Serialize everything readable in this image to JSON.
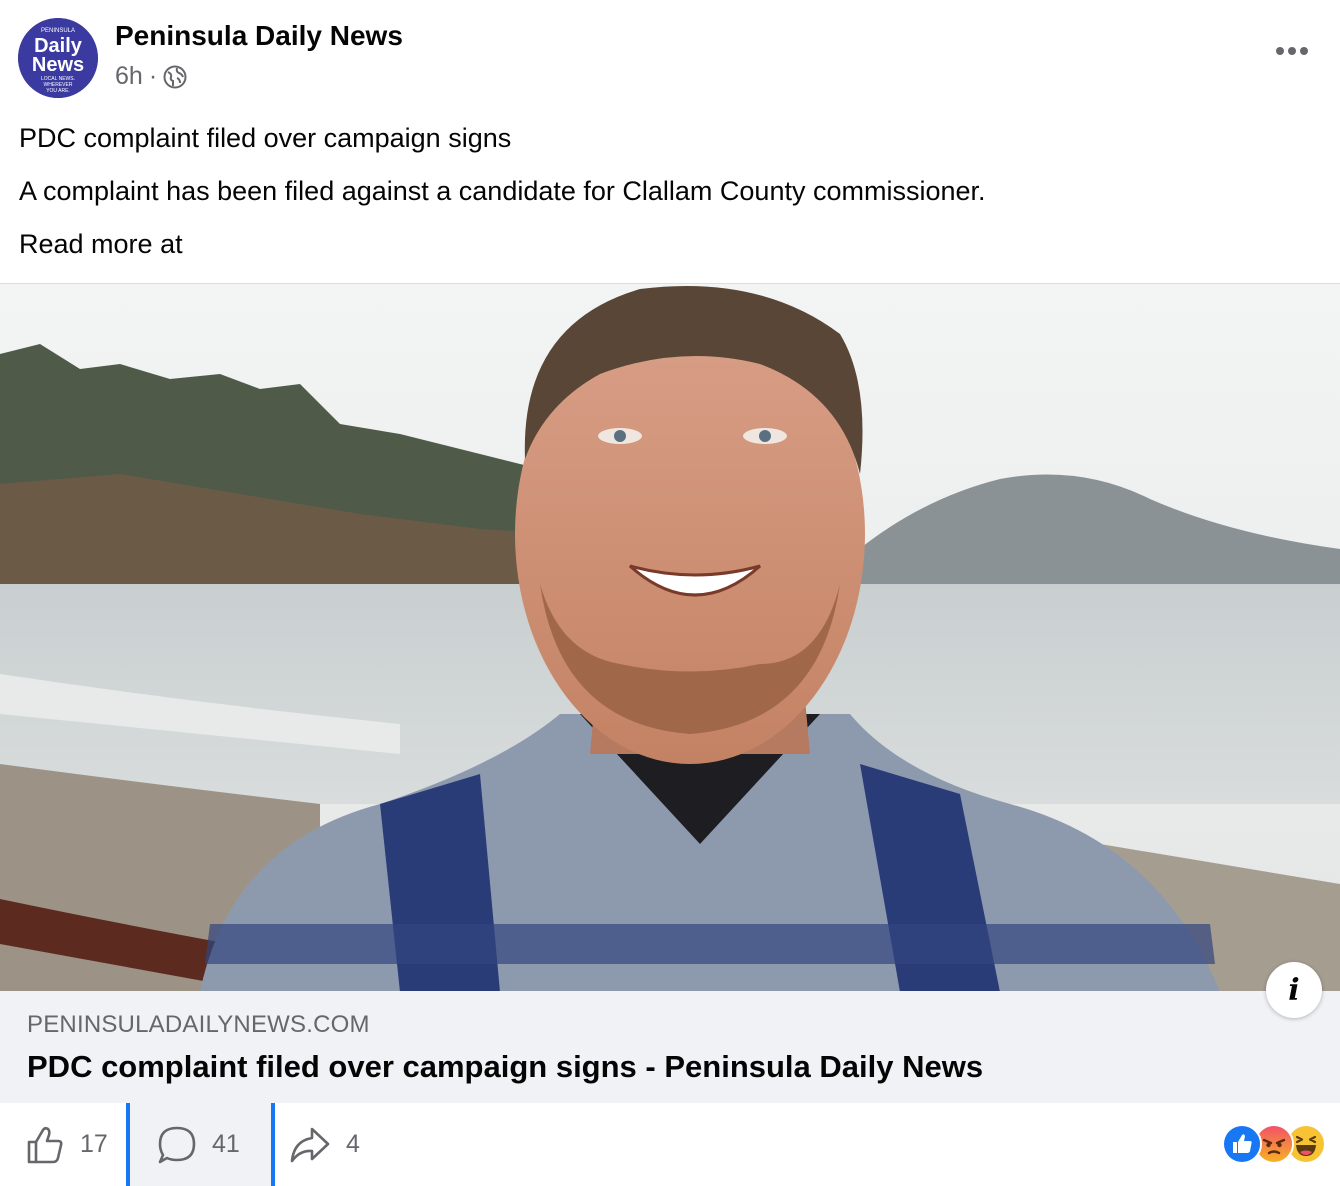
{
  "post": {
    "page_name": "Peninsula Daily News",
    "time": "6h",
    "separator": "·",
    "avatar": {
      "top_text": "PENINSULA",
      "line1": "Daily",
      "line2": "News",
      "tagline": [
        "LOCAL NEWS.",
        "WHEREVER",
        "YOU ARE."
      ],
      "color": "#3b3aa0"
    },
    "lines": [
      "PDC complaint filed over campaign signs",
      "A complaint has been filed against a candidate for Clallam County commissioner.",
      "Read more at"
    ]
  },
  "link": {
    "domain": "PENINSULADAILYNEWS.COM",
    "title": "PDC complaint filed over campaign signs - Peninsula Daily News",
    "info_icon": "info-icon"
  },
  "actions": {
    "likes": "17",
    "comments": "41",
    "shares": "4"
  },
  "reactions": [
    "like-reaction-icon",
    "angry-reaction-icon",
    "haha-reaction-icon"
  ],
  "colors": {
    "accent": "#1877f2",
    "secondary_text": "#65676b",
    "link_box_bg": "#f0f2f5"
  }
}
